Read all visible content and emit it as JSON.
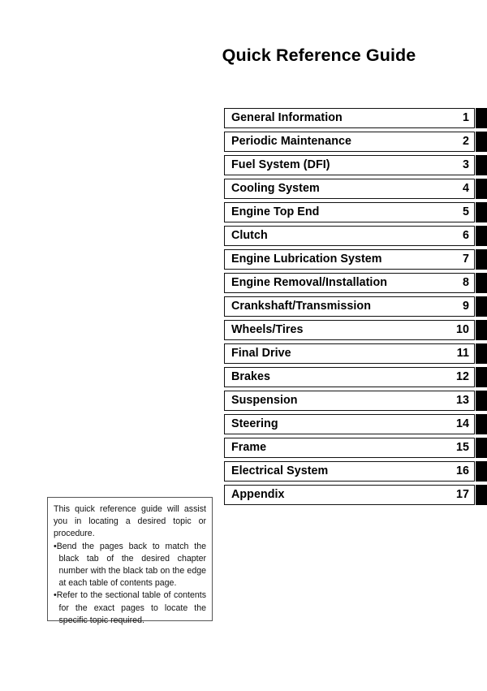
{
  "page": {
    "title": "Quick Reference Guide",
    "background_color": "#ffffff",
    "text_color": "#000000",
    "tab_color": "#000000"
  },
  "chapters": [
    {
      "name": "General Information",
      "number": "1"
    },
    {
      "name": "Periodic Maintenance",
      "number": "2"
    },
    {
      "name": "Fuel System (DFI)",
      "number": "3"
    },
    {
      "name": "Cooling System",
      "number": "4"
    },
    {
      "name": "Engine Top End",
      "number": "5"
    },
    {
      "name": "Clutch",
      "number": "6"
    },
    {
      "name": "Engine Lubrication System",
      "number": "7"
    },
    {
      "name": "Engine Removal/Installation",
      "number": "8"
    },
    {
      "name": "Crankshaft/Transmission",
      "number": "9"
    },
    {
      "name": "Wheels/Tires",
      "number": "10"
    },
    {
      "name": "Final Drive",
      "number": "11"
    },
    {
      "name": "Brakes",
      "number": "12"
    },
    {
      "name": "Suspension",
      "number": "13"
    },
    {
      "name": "Steering",
      "number": "14"
    },
    {
      "name": "Frame",
      "number": "15"
    },
    {
      "name": "Electrical System",
      "number": "16"
    },
    {
      "name": "Appendix",
      "number": "17"
    }
  ],
  "note": {
    "intro": "This quick reference guide will assist you in locating a desired topic or procedure.",
    "bullets": [
      "•Bend the pages back to match the black tab of the desired chapter number with the black tab on the edge at each table of contents page.",
      "•Refer to the sectional table of contents for the exact pages to locate the specific topic required."
    ]
  }
}
